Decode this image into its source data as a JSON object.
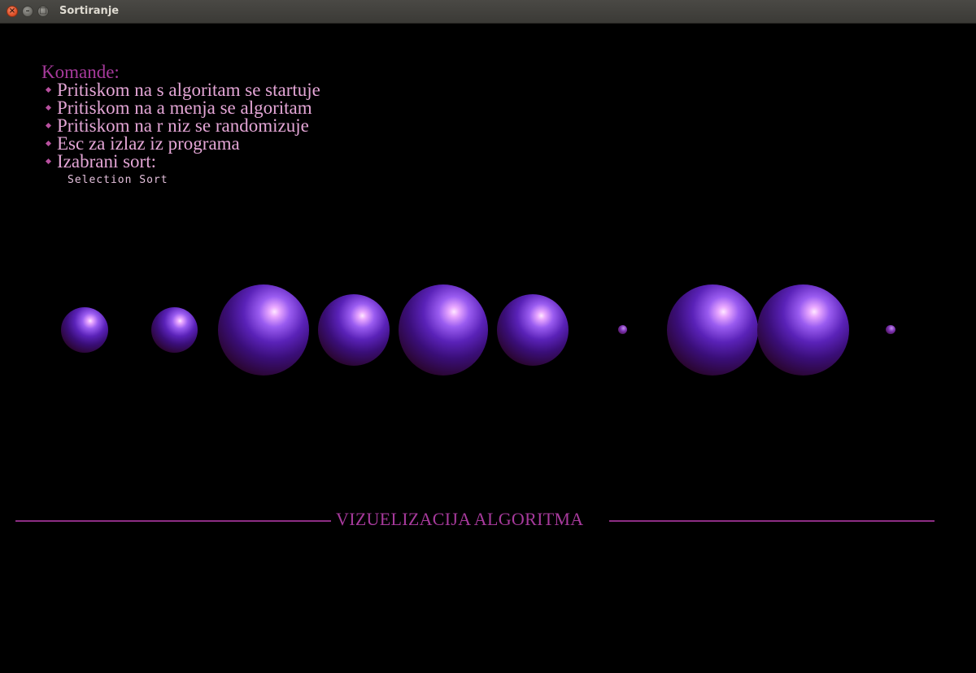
{
  "window": {
    "title": "Sortiranje",
    "close_glyph": "×",
    "minimize_glyph": "–",
    "maximize_glyph": "□"
  },
  "commands": {
    "heading": "Komande:",
    "items": [
      "Pritiskom na s algoritam se startuje",
      "Pritiskom na a menja se algoritam",
      "Pritiskom na r niz se randomizuje",
      "Esc za izlaz iz programa",
      "Izabrani sort:"
    ],
    "selected_sort": "Selection Sort"
  },
  "footer": {
    "title": "VIZUELIZACIJA ALGORITMA"
  },
  "colors": {
    "background": "#000000",
    "heading": "#a73a9c",
    "command_text": "#e4a6d6",
    "sphere_highlight": "#e9a8ff",
    "sphere_base": "#2a0630"
  },
  "icons": [
    "close-icon",
    "minimize-icon",
    "maximize-icon",
    "diamond-bullet-icon"
  ]
}
